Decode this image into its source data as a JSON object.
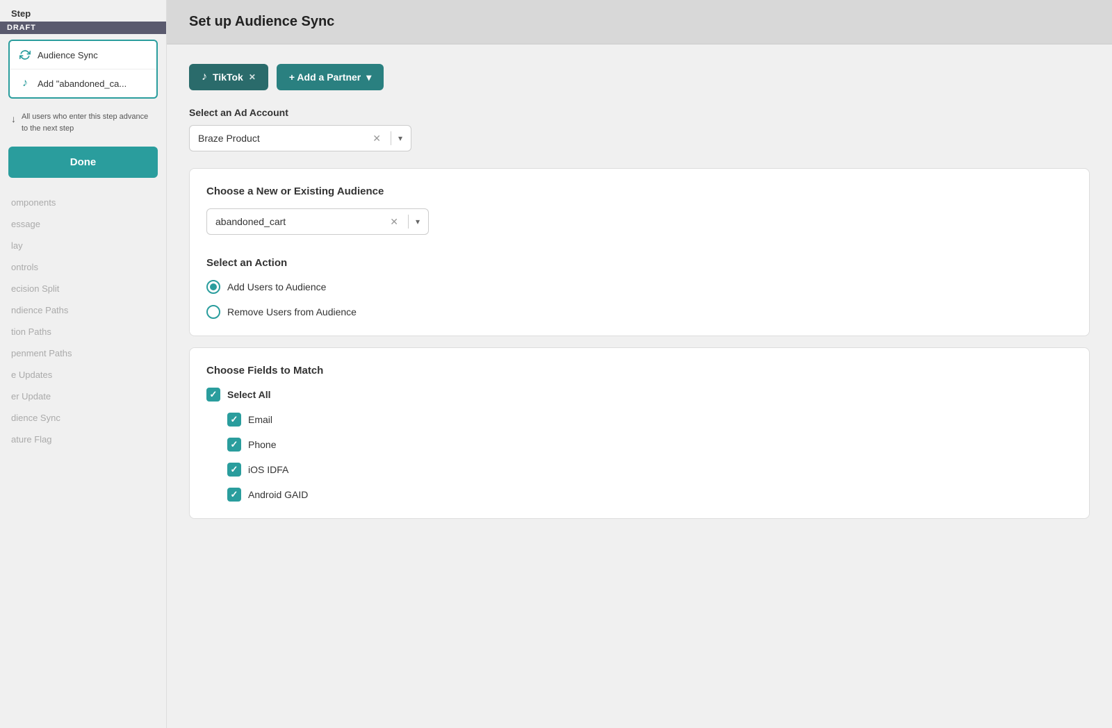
{
  "sidebar": {
    "step_label": "Step",
    "draft_label": "DRAFT",
    "items": [
      {
        "id": "audience-sync",
        "label": "Audience Sync",
        "icon": "sync"
      },
      {
        "id": "add-abandoned",
        "label": "Add \"abandoned_ca...",
        "icon": "tiktok"
      }
    ],
    "info_text": "All users who enter this step advance to the next step",
    "done_button": "Done",
    "nav_items": [
      "omponents",
      "essage",
      "lay",
      "ontrols",
      "ecision Split",
      "ndience Paths",
      "tion Paths",
      "penment Paths",
      "e Updates",
      "er Update",
      "dience Sync",
      "ature Flag"
    ]
  },
  "main": {
    "header_title": "Set up Audience Sync",
    "partner_buttons": [
      {
        "label": "TikTok",
        "has_close": true
      },
      {
        "label": "+ Add a Partner",
        "has_close": false,
        "has_arrow": true
      }
    ],
    "ad_account_section": {
      "label": "Select an Ad Account",
      "value": "Braze Product"
    },
    "audience_section": {
      "label": "Choose a New or Existing Audience",
      "value": "abandoned_cart"
    },
    "action_section": {
      "label": "Select an Action",
      "options": [
        {
          "label": "Add Users to Audience",
          "selected": true
        },
        {
          "label": "Remove Users from Audience",
          "selected": false
        }
      ]
    },
    "fields_section": {
      "label": "Choose Fields to Match",
      "select_all": {
        "label": "Select All",
        "checked": true
      },
      "fields": [
        {
          "label": "Email",
          "checked": true
        },
        {
          "label": "Phone",
          "checked": true
        },
        {
          "label": "iOS IDFA",
          "checked": true
        },
        {
          "label": "Android GAID",
          "checked": true
        }
      ]
    }
  }
}
